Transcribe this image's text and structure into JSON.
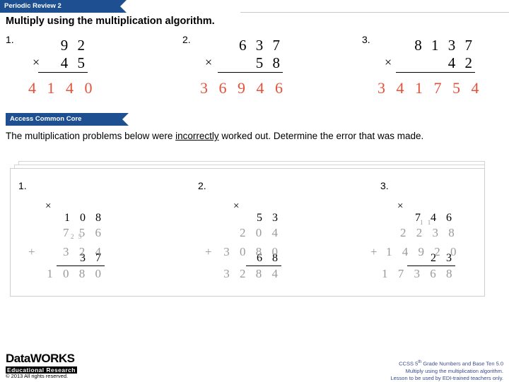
{
  "banners": {
    "periodic_review": "Periodic Review 2",
    "access_common_core": "Access Common Core"
  },
  "title": "Multiply using the multiplication algorithm.",
  "prose": {
    "before": "The multiplication problems below were ",
    "underlined": "incorrectly",
    "after": " worked out. Determine the error that was made."
  },
  "top_problems": [
    {
      "number": "1.",
      "multiplicand": "9 2",
      "multiplier": "4 5",
      "times_sign": "×",
      "answer": "4 1 4 0"
    },
    {
      "number": "2.",
      "multiplicand": "6 3 7",
      "multiplier": "5 8",
      "times_sign": "×",
      "answer": "3 6 9 4 6"
    },
    {
      "number": "3.",
      "multiplicand": "8 1 3 7",
      "multiplier": "4 2",
      "times_sign": "×",
      "answer": "3 4 1 7 5 4"
    }
  ],
  "bottom_problems": [
    {
      "number": "1.",
      "multiplicand": "1 0 8",
      "multiplier": "3 7",
      "times_sign": "×",
      "partial1": "7 5 6",
      "partial2": "3 2 4",
      "plus_sign": "+",
      "total": "1 0 8 0",
      "carries": "2 5"
    },
    {
      "number": "2.",
      "multiplicand": "5 3",
      "multiplier": "6 8",
      "times_sign": "×",
      "partial1": "2 0 4",
      "partial2": "3 0 8 0",
      "plus_sign": "+",
      "total": "3 2 8 4",
      "carries": ""
    },
    {
      "number": "3.",
      "multiplicand": "7 4 6",
      "multiplier": "2 3",
      "times_sign": "×",
      "partial1": "2 2 3 8",
      "partial2": "1 4 9 2 0",
      "plus_sign": "+",
      "total": "1 7 3 6 8",
      "carries": "1 1"
    }
  ],
  "footer": {
    "logo_line1_a": "Data",
    "logo_line1_b": "WORKS",
    "logo_line2": "Educational Research",
    "copyright": "© 2013 All rights reserved.",
    "credit_line1": "CCSS 5",
    "credit_line1_sup": "th",
    "credit_line1_rest": " Grade Numbers and Base Ten 5.0",
    "credit_line2": "Multiply using the multiplication algorithm.",
    "credit_line3": "Lesson to be used by EDI-trained teachers only."
  },
  "colors": {
    "banner": "#1d4f91",
    "answer_red": "#e8503a",
    "grey_work": "#9a9a9a",
    "credit_blue": "#3a4a8a"
  }
}
